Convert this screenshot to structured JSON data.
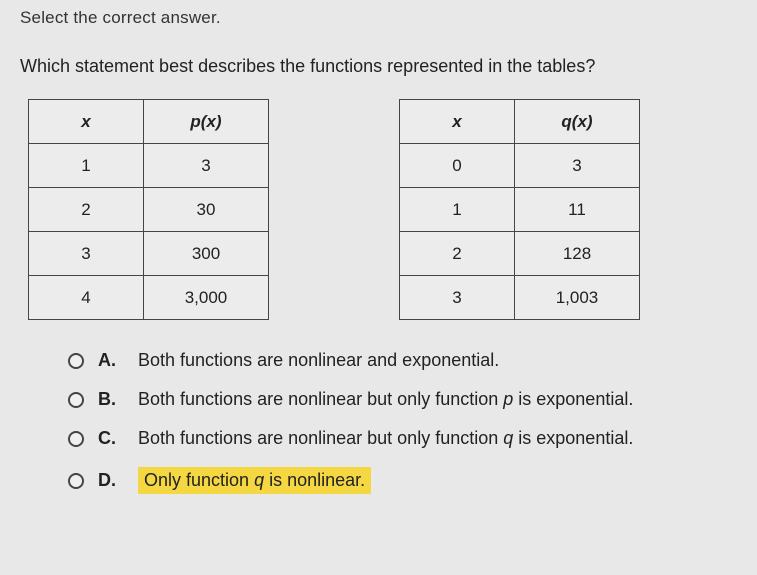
{
  "partial_instruction": "Select the correct answer.",
  "question": "Which statement best describes the functions represented in the tables?",
  "table_p": {
    "headers": [
      "x",
      "p(x)"
    ],
    "rows": [
      [
        "1",
        "3"
      ],
      [
        "2",
        "30"
      ],
      [
        "3",
        "300"
      ],
      [
        "4",
        "3,000"
      ]
    ]
  },
  "table_q": {
    "headers": [
      "x",
      "q(x)"
    ],
    "rows": [
      [
        "0",
        "3"
      ],
      [
        "1",
        "11"
      ],
      [
        "2",
        "128"
      ],
      [
        "3",
        "1,003"
      ]
    ]
  },
  "options": {
    "a": {
      "letter": "A.",
      "text": "Both functions are nonlinear and exponential."
    },
    "b": {
      "letter": "B.",
      "text_pre": "Both functions are nonlinear but only function ",
      "fn": "p",
      "text_post": " is exponential."
    },
    "c": {
      "letter": "C.",
      "text_pre": "Both functions are nonlinear but only function ",
      "fn": "q",
      "text_post": " is exponential."
    },
    "d": {
      "letter": "D.",
      "text_pre": "Only function ",
      "fn": "q",
      "text_post": " is nonlinear."
    }
  }
}
